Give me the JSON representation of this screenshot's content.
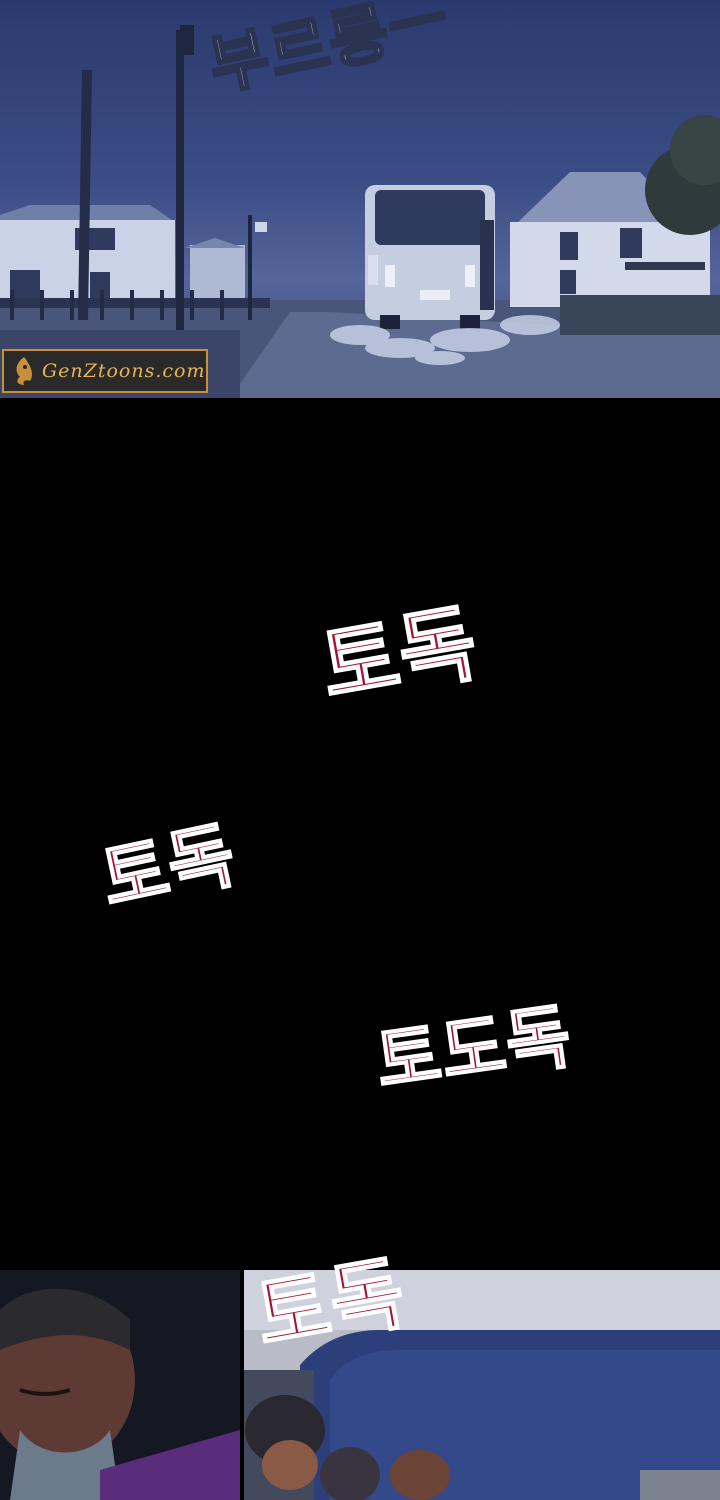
{
  "sfx": {
    "engine": "부르릉ㅡ",
    "tap_1": "토독",
    "tap_2": "토독",
    "tap_3": "토도독",
    "tap_4": "토독"
  },
  "watermark": {
    "text": "GenZtoons.com"
  },
  "colors": {
    "night_sky": "#2b3a6e",
    "sfx_red": "#a11432",
    "watermark_gold": "#e8b355"
  }
}
